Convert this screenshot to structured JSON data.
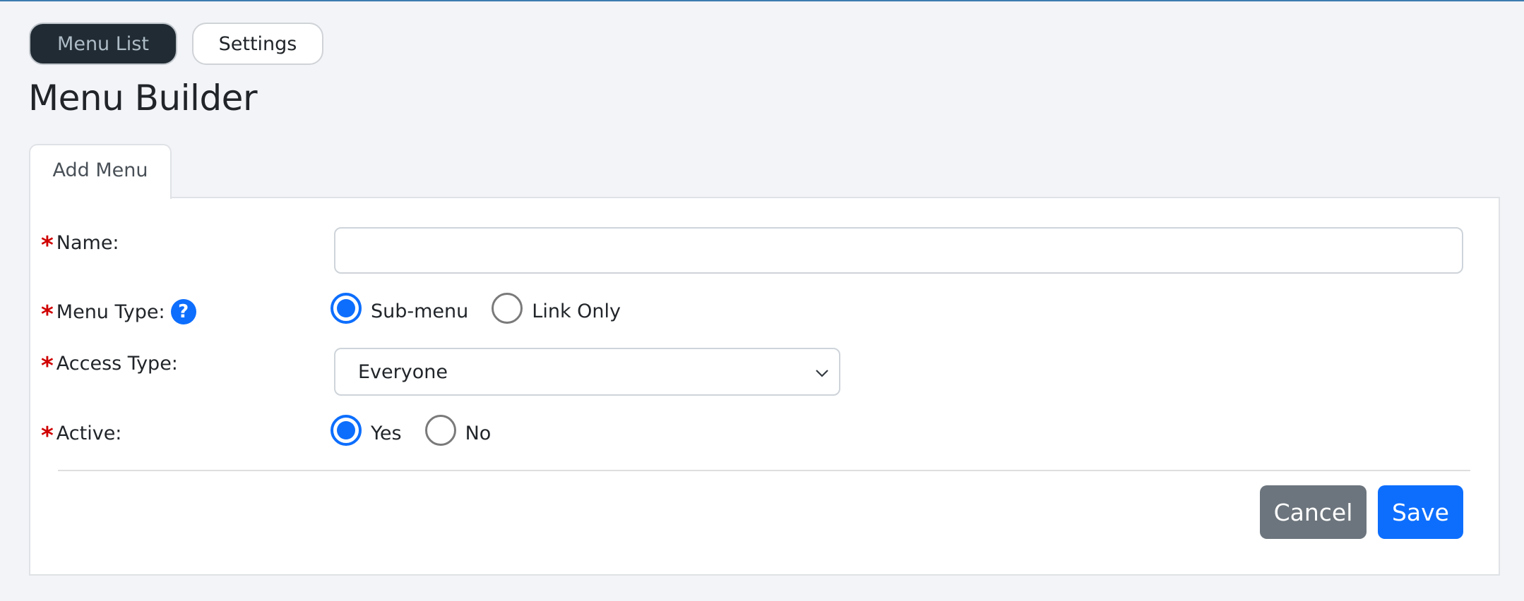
{
  "top_nav": {
    "buttons": [
      {
        "label": "Menu List",
        "active": true
      },
      {
        "label": "Settings",
        "active": false
      }
    ]
  },
  "page": {
    "title": "Menu Builder"
  },
  "tabs": [
    {
      "label": "Add Menu",
      "active": true
    }
  ],
  "form": {
    "required_marker": "*",
    "name": {
      "label": "Name:",
      "value": "",
      "placeholder": ""
    },
    "menu_type": {
      "label": "Menu Type:",
      "help_icon": "question-circle-icon",
      "help_glyph": "?",
      "options": [
        {
          "label": "Sub-menu",
          "checked": true
        },
        {
          "label": "Link Only",
          "checked": false
        }
      ]
    },
    "access_type": {
      "label": "Access Type:",
      "selected": "Everyone",
      "icon": "chevron-down-icon"
    },
    "active": {
      "label": "Active:",
      "options": [
        {
          "label": "Yes",
          "checked": true
        },
        {
          "label": "No",
          "checked": false
        }
      ]
    }
  },
  "actions": {
    "cancel_label": "Cancel",
    "save_label": "Save"
  },
  "colors": {
    "primary": "#0d6efd",
    "secondary": "#6c757d",
    "dark": "#212b33",
    "required": "#d00000",
    "background": "#f3f4f8"
  }
}
